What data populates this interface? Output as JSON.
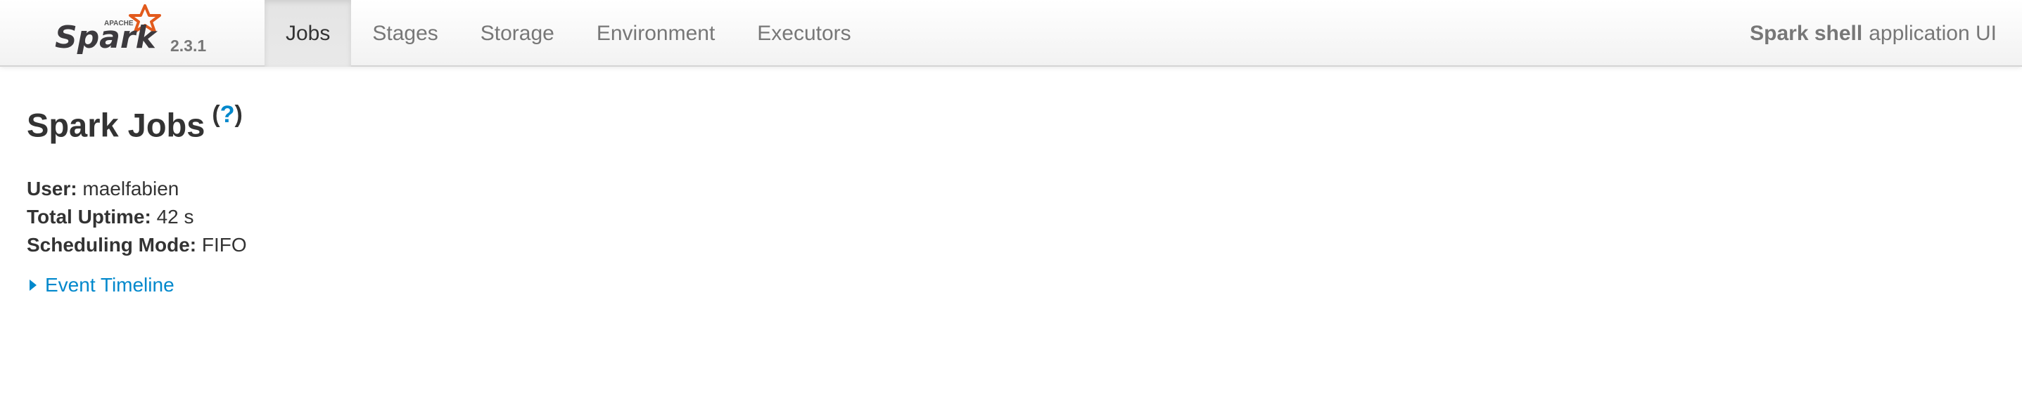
{
  "brand": {
    "logo_text": "Spark",
    "logo_small_text": "APACHE",
    "version": "2.3.1"
  },
  "nav": {
    "tabs": [
      {
        "label": "Jobs",
        "active": true
      },
      {
        "label": "Stages",
        "active": false
      },
      {
        "label": "Storage",
        "active": false
      },
      {
        "label": "Environment",
        "active": false
      },
      {
        "label": "Executors",
        "active": false
      }
    ]
  },
  "app": {
    "title_bold": "Spark shell",
    "title_rest": "application UI"
  },
  "page": {
    "title": "Spark Jobs",
    "help_open": "(",
    "help_link": "?",
    "help_close": ")"
  },
  "info": {
    "user_label": "User:",
    "user_value": "maelfabien",
    "uptime_label": "Total Uptime:",
    "uptime_value": "42 s",
    "mode_label": "Scheduling Mode:",
    "mode_value": "FIFO"
  },
  "timeline": {
    "label": "Event Timeline"
  },
  "colors": {
    "link": "#0088cc",
    "logo_star": "#e25a1c",
    "text": "#333333",
    "nav_text": "#777777"
  }
}
